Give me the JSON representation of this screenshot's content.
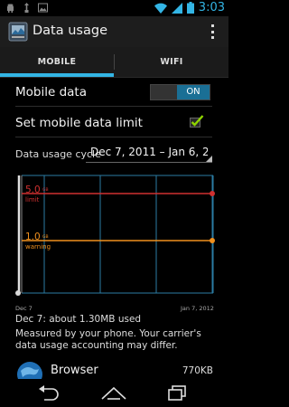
{
  "status_bar": {
    "time": "3:03",
    "left_icons": [
      "android-icon",
      "usb-icon",
      "image-icon"
    ],
    "right_icons": [
      "wifi-icon",
      "signal-icon",
      "battery-icon"
    ]
  },
  "action_bar": {
    "title": "Data usage",
    "app_icon": "data-usage-icon",
    "overflow_icon": "overflow-menu-icon"
  },
  "tabs": [
    {
      "label": "MOBILE",
      "selected": true
    },
    {
      "label": "WIFI",
      "selected": false
    }
  ],
  "settings": {
    "mobile_data_label": "Mobile data",
    "mobile_data_toggle": "ON",
    "data_limit_label": "Set mobile data limit",
    "data_limit_checked": true
  },
  "cycle": {
    "label": "Data usage cycle",
    "value": "Dec 7, 2011 – Jan 6, 2..."
  },
  "chart_data": {
    "type": "line",
    "x_start_label": "Dec 7",
    "x_end_label": "Jan 7, 2012",
    "limit": {
      "value": "5.0",
      "unit": "GB",
      "label": "limit",
      "gb": 5.0,
      "color": "#d03030"
    },
    "warning": {
      "value": "1.0",
      "unit": "GB",
      "label": "warning",
      "gb": 1.0,
      "color": "#f0901e"
    },
    "grid_color": "#2b7ca3"
  },
  "usage_summary": "Dec 7: about 1.30MB used",
  "measured_note": "Measured by your phone. Your carrier's data usage accounting may differ.",
  "apps": [
    {
      "name": "Browser",
      "size": "770KB",
      "icon": "browser-globe-icon"
    }
  ],
  "nav": {
    "back_icon": "back-icon",
    "home_icon": "home-icon",
    "recents_icon": "recent-apps-icon"
  }
}
